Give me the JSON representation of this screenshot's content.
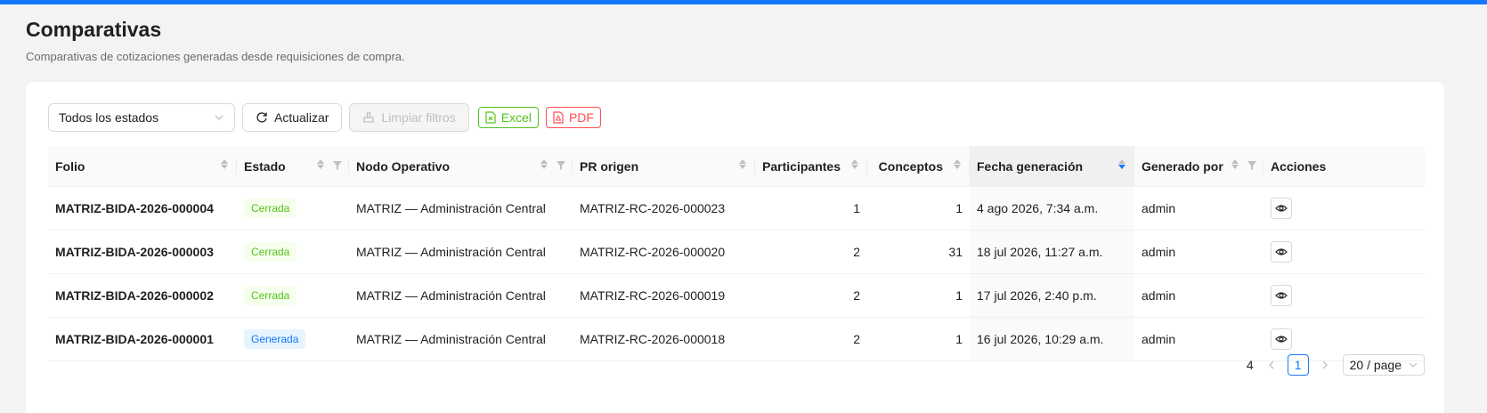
{
  "header": {
    "title": "Comparativas",
    "subtitle": "Comparativas de cotizaciones generadas desde requisiciones de compra."
  },
  "toolbar": {
    "status_filter": "Todos los estados",
    "refresh_label": "Actualizar",
    "clear_filters_label": "Limpiar filtros",
    "excel_label": "Excel",
    "pdf_label": "PDF"
  },
  "table": {
    "columns": [
      "Folio",
      "Estado",
      "Nodo Operativo",
      "PR origen",
      "Participantes",
      "Conceptos",
      "Fecha generación",
      "Generado por",
      "Acciones"
    ],
    "sorted_column": "Fecha generación",
    "sort_direction": "descending",
    "rows": [
      {
        "folio": "MATRIZ-BIDA-2026-000004",
        "estado": "Cerrada",
        "nodo": "MATRIZ — Administración Central",
        "pr": "MATRIZ-RC-2026-000023",
        "participantes": "1",
        "conceptos": "1",
        "fecha": "4 ago 2026, 7:34 a.m.",
        "generado_por": "admin"
      },
      {
        "folio": "MATRIZ-BIDA-2026-000003",
        "estado": "Cerrada",
        "nodo": "MATRIZ — Administración Central",
        "pr": "MATRIZ-RC-2026-000020",
        "participantes": "2",
        "conceptos": "31",
        "fecha": "18 jul 2026, 11:27 a.m.",
        "generado_por": "admin"
      },
      {
        "folio": "MATRIZ-BIDA-2026-000002",
        "estado": "Cerrada",
        "nodo": "MATRIZ — Administración Central",
        "pr": "MATRIZ-RC-2026-000019",
        "participantes": "2",
        "conceptos": "1",
        "fecha": "17 jul 2026, 2:40 p.m.",
        "generado_por": "admin"
      },
      {
        "folio": "MATRIZ-BIDA-2026-000001",
        "estado": "Generada",
        "nodo": "MATRIZ — Administración Central",
        "pr": "MATRIZ-RC-2026-000018",
        "participantes": "2",
        "conceptos": "1",
        "fecha": "16 jul 2026, 10:29 a.m.",
        "generado_por": "admin"
      }
    ]
  },
  "pagination": {
    "total": "4",
    "current_page": "1",
    "page_size": "20 / page"
  },
  "colors": {
    "accent": "#1677ff",
    "status_cerrada": "#52c41a",
    "status_generada": "#1677ff",
    "excel": "#52c41a",
    "pdf": "#ff4d4f"
  }
}
